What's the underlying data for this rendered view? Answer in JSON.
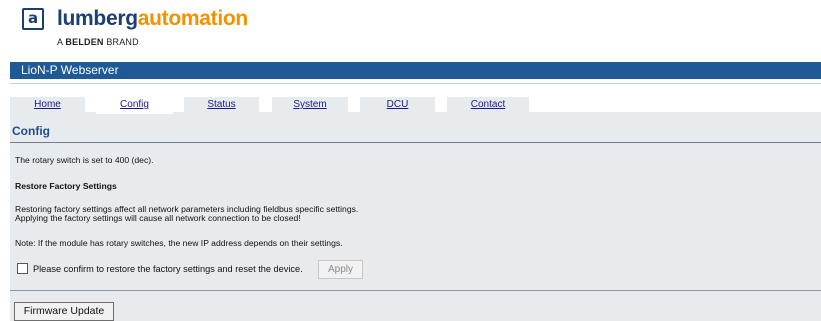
{
  "logo": {
    "mark_letter": "a",
    "name_part1": "lumberg",
    "name_part2": "automation",
    "sub_prefix": "A ",
    "sub_brand": "BELDEN",
    "sub_suffix": " BRAND",
    "colors": {
      "primary": "#1b3f73",
      "accent": "#f39200"
    }
  },
  "titlebar": {
    "title": "LioN-P Webserver",
    "color": "#1f5a96"
  },
  "tabs": [
    {
      "label": "Home",
      "active": false
    },
    {
      "label": "Config",
      "active": true
    },
    {
      "label": "Status",
      "active": false
    },
    {
      "label": "System",
      "active": false
    },
    {
      "label": "DCU",
      "active": false
    },
    {
      "label": "Contact",
      "active": false
    }
  ],
  "config": {
    "heading": "Config",
    "rotary_text": "The rotary switch is set to 400 (dec).",
    "restore_heading": "Restore Factory Settings",
    "warning_line1": "Restoring factory settings affect all network parameters including fieldbus specific settings.",
    "warning_line2": "Applying the factory settings will cause all network connection to be closed!",
    "note": "Note: If the module has rotary switches, the new IP address depends on their settings.",
    "confirm_label": "Please confirm to restore the factory settings and reset the device.",
    "confirm_checked": false,
    "apply_label": "Apply",
    "firmware_button": "Firmware Update"
  }
}
